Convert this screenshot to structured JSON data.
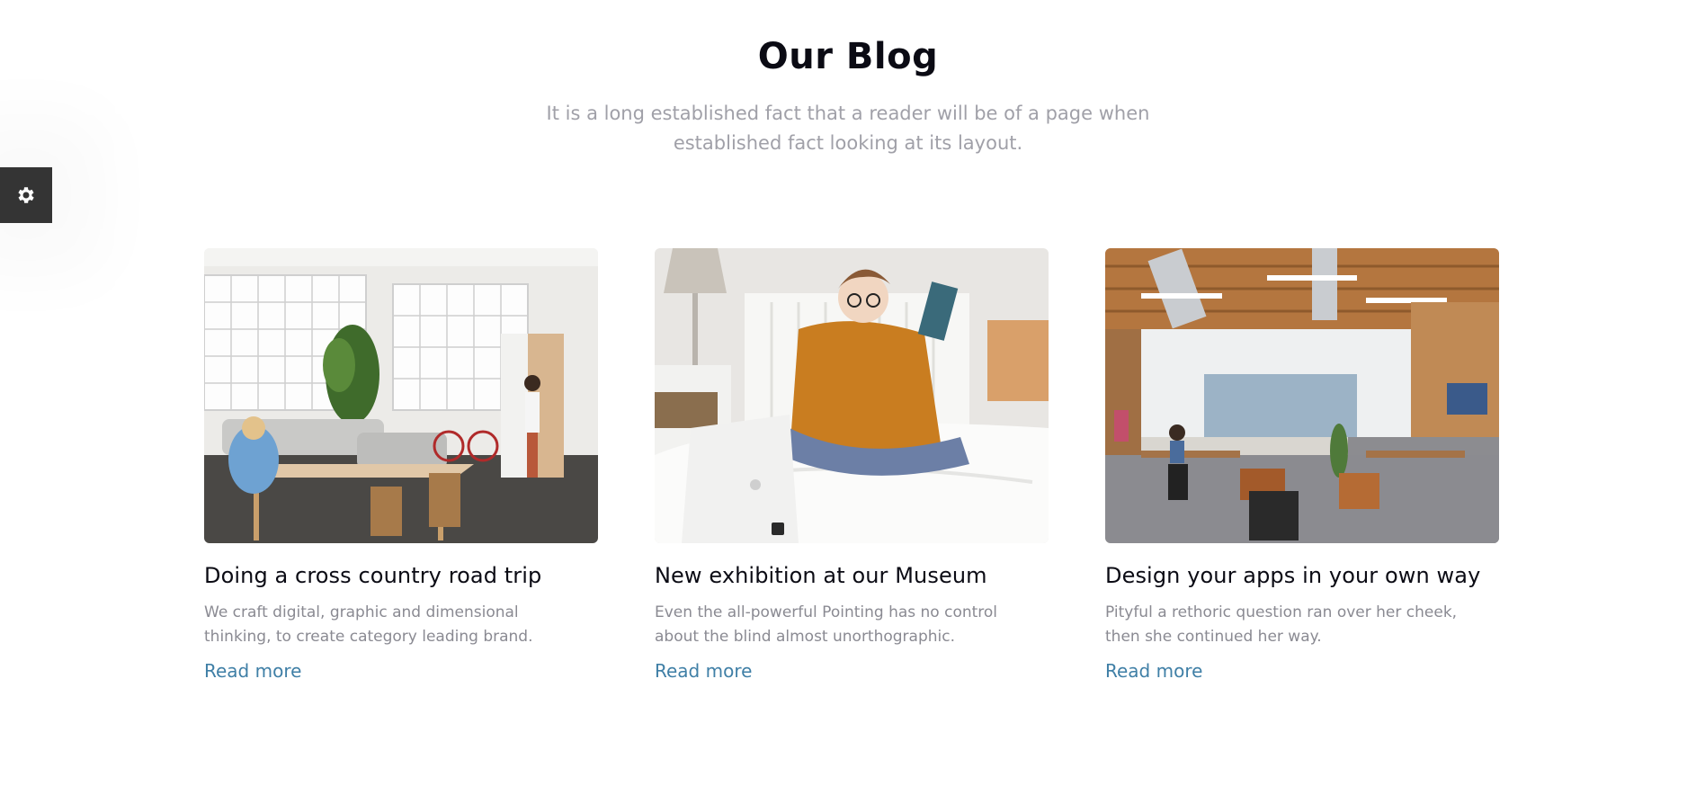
{
  "settings": {
    "icon": "gear-icon"
  },
  "section": {
    "title": "Our Blog",
    "subtitle": "It is a long established fact that a reader will be of a page when established fact looking at its layout."
  },
  "posts": [
    {
      "title": "Doing a cross country road trip",
      "excerpt": "We craft digital, graphic and dimensional thinking, to create category leading brand.",
      "link": "Read more"
    },
    {
      "title": "New exhibition at our Museum",
      "excerpt": "Even the all-powerful Pointing has no control about the blind almost unorthographic.",
      "link": "Read more"
    },
    {
      "title": "Design your apps in your own way",
      "excerpt": "Pityful a rethoric question ran over her cheek, then she continued her way.",
      "link": "Read more"
    }
  ],
  "colors": {
    "title": "#0b0b14",
    "subtitle": "#a0a0a8",
    "excerpt": "#8a8a92",
    "link": "#3f7fa6",
    "settings_bg": "#343434"
  }
}
